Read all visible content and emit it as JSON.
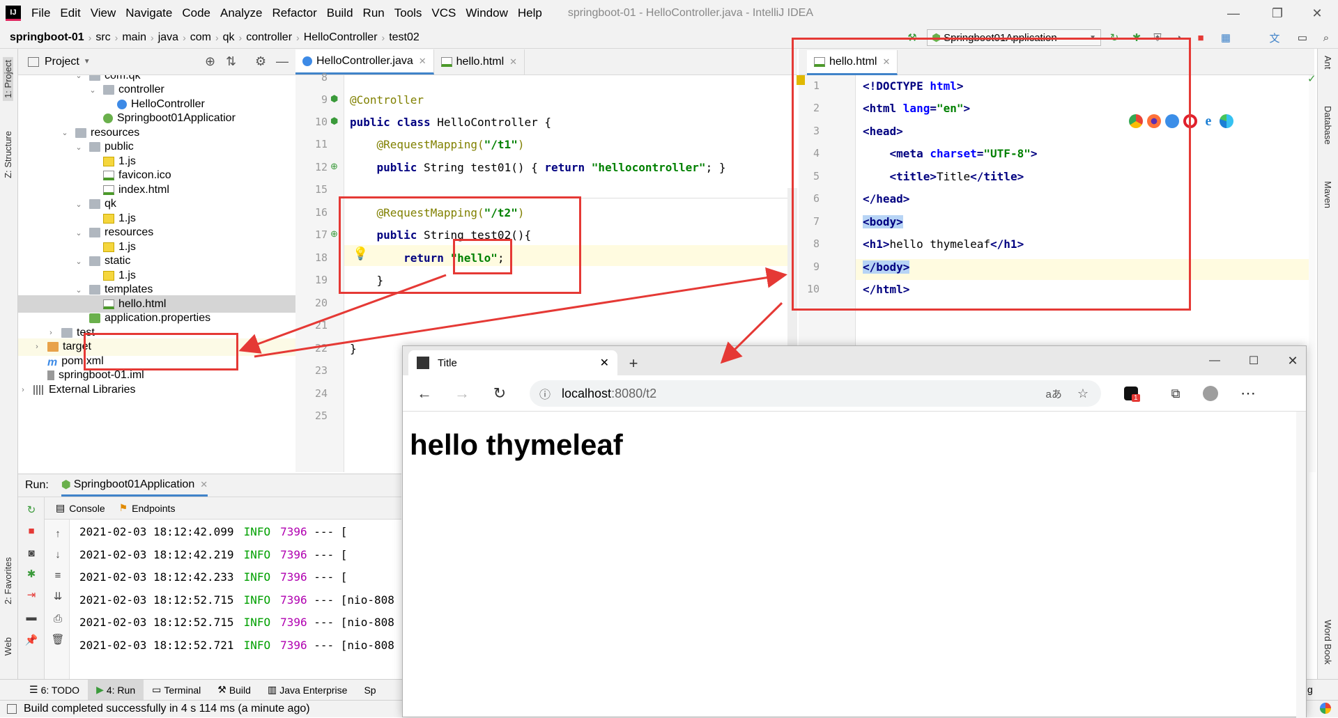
{
  "menubar": {
    "items": [
      "File",
      "Edit",
      "View",
      "Navigate",
      "Code",
      "Analyze",
      "Refactor",
      "Build",
      "Run",
      "Tools",
      "VCS",
      "Window",
      "Help"
    ],
    "title": "springboot-01 - HelloController.java - IntelliJ IDEA",
    "app_icon": "IJ"
  },
  "navbar": {
    "crumbs": [
      "springboot-01",
      "src",
      "main",
      "java",
      "com",
      "qk",
      "controller",
      "HelloController",
      "test02"
    ],
    "run_config": "Springboot01Application"
  },
  "leftstrip": {
    "project": "1: Project",
    "structure": "Z: Structure",
    "favorites": "2: Favorites",
    "web": "Web"
  },
  "project": {
    "title": "Project",
    "tree": [
      {
        "label": "com.qk",
        "kind": "folder",
        "open": true
      },
      {
        "label": "controller",
        "kind": "folder",
        "open": true
      },
      {
        "label": "HelloController",
        "kind": "class"
      },
      {
        "label": "Springboot01Applicatior",
        "kind": "spring"
      },
      {
        "label": "resources",
        "kind": "folder",
        "open": true
      },
      {
        "label": "public",
        "kind": "folder",
        "open": true
      },
      {
        "label": "1.js",
        "kind": "js"
      },
      {
        "label": "favicon.ico",
        "kind": "ico"
      },
      {
        "label": "index.html",
        "kind": "html"
      },
      {
        "label": "qk",
        "kind": "folder",
        "open": true
      },
      {
        "label": "1.js",
        "kind": "js"
      },
      {
        "label": "resources",
        "kind": "folder",
        "open": true
      },
      {
        "label": "1.js",
        "kind": "js"
      },
      {
        "label": "static",
        "kind": "folder",
        "open": true
      },
      {
        "label": "1.js",
        "kind": "js"
      },
      {
        "label": "templates",
        "kind": "folder",
        "open": true
      },
      {
        "label": "hello.html",
        "kind": "html",
        "selected": true
      },
      {
        "label": "application.properties",
        "kind": "props"
      },
      {
        "label": "test",
        "kind": "folder",
        "open": false
      },
      {
        "label": "target",
        "kind": "folder-orange",
        "open": false
      },
      {
        "label": "pom.xml",
        "kind": "xml"
      },
      {
        "label": "springboot-01.iml",
        "kind": "iml"
      },
      {
        "label": "External Libraries",
        "kind": "lib",
        "open": false
      }
    ]
  },
  "editor": {
    "tabs": [
      "HelloController.java",
      "hello.html"
    ],
    "line_numbers": [
      "8",
      "9",
      "10",
      "11",
      "12",
      "15",
      "16",
      "17",
      "18",
      "19",
      "20",
      "21",
      "22",
      "23",
      "24",
      "25"
    ],
    "lines": {
      "l9": "@Controller",
      "l10a": "public class ",
      "l10b": "HelloController {",
      "l11a": "    ",
      "l11b": "@RequestMapping(",
      "l11c": "\"/t1\"",
      "l11d": ")",
      "l12a": "    public ",
      "l12b": "String test01() { ",
      "l12c": "return ",
      "l12d": "\"hellocontroller\"",
      "l12e": "; }",
      "l16a": "    ",
      "l16b": "@RequestMapping(",
      "l16c": "\"/t2\"",
      "l16d": ")",
      "l17a": "    public ",
      "l17b": "String test02(){",
      "l18a": "        return ",
      "l18b": "\"hello\"",
      "l18c": ";",
      "l19": "    }",
      "l22": "}"
    }
  },
  "html_editor": {
    "tab": "hello.html",
    "line_numbers": [
      "1",
      "2",
      "3",
      "4",
      "5",
      "6",
      "7",
      "8",
      "9",
      "10"
    ]
  },
  "rightstrip": {
    "ant": "Ant",
    "database": "Database",
    "maven": "Maven",
    "wordbook": "Word Book"
  },
  "run": {
    "label": "Run:",
    "config": "Springboot01Application",
    "tabs": [
      "Console",
      "Endpoints"
    ],
    "logs": [
      {
        "ts": "2021-02-03 18:12:42.099",
        "level": "INFO",
        "pid": "7396",
        "rest": " --- ["
      },
      {
        "ts": "2021-02-03 18:12:42.219",
        "level": "INFO",
        "pid": "7396",
        "rest": " --- ["
      },
      {
        "ts": "2021-02-03 18:12:42.233",
        "level": "INFO",
        "pid": "7396",
        "rest": " --- ["
      },
      {
        "ts": "2021-02-03 18:12:52.715",
        "level": "INFO",
        "pid": "7396",
        "rest": " --- [nio-808"
      },
      {
        "ts": "2021-02-03 18:12:52.715",
        "level": "INFO",
        "pid": "7396",
        "rest": " --- [nio-808"
      },
      {
        "ts": "2021-02-03 18:12:52.721",
        "level": "INFO",
        "pid": "7396",
        "rest": " --- [nio-808"
      }
    ]
  },
  "bottombar": {
    "tabs": [
      "6: TODO",
      "4: Run",
      "Terminal",
      "Build",
      "Java Enterprise",
      "Sp"
    ],
    "right": "g"
  },
  "status": {
    "text": "Build completed successfully in 4 s 114 ms (a minute ago)"
  },
  "browser": {
    "tab_title": "Title",
    "url_host": "localhost",
    "url_rest": ":8080/t2",
    "heading": "hello thymeleaf",
    "read_aloud": "aあ",
    "badge": "1"
  }
}
